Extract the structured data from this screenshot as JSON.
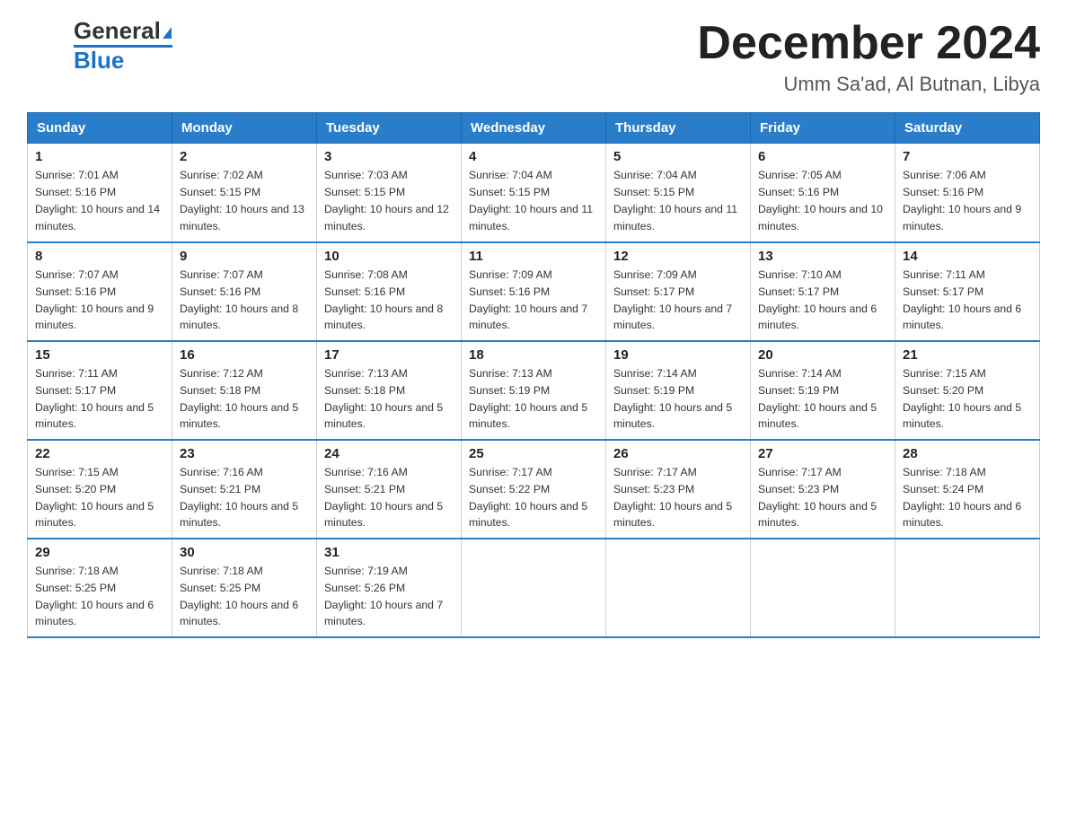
{
  "header": {
    "logo_general": "General",
    "logo_blue": "Blue",
    "month": "December 2024",
    "location": "Umm Sa'ad, Al Butnan, Libya"
  },
  "days_of_week": [
    "Sunday",
    "Monday",
    "Tuesday",
    "Wednesday",
    "Thursday",
    "Friday",
    "Saturday"
  ],
  "weeks": [
    [
      {
        "day": "1",
        "sunrise": "7:01 AM",
        "sunset": "5:16 PM",
        "daylight": "10 hours and 14 minutes."
      },
      {
        "day": "2",
        "sunrise": "7:02 AM",
        "sunset": "5:15 PM",
        "daylight": "10 hours and 13 minutes."
      },
      {
        "day": "3",
        "sunrise": "7:03 AM",
        "sunset": "5:15 PM",
        "daylight": "10 hours and 12 minutes."
      },
      {
        "day": "4",
        "sunrise": "7:04 AM",
        "sunset": "5:15 PM",
        "daylight": "10 hours and 11 minutes."
      },
      {
        "day": "5",
        "sunrise": "7:04 AM",
        "sunset": "5:15 PM",
        "daylight": "10 hours and 11 minutes."
      },
      {
        "day": "6",
        "sunrise": "7:05 AM",
        "sunset": "5:16 PM",
        "daylight": "10 hours and 10 minutes."
      },
      {
        "day": "7",
        "sunrise": "7:06 AM",
        "sunset": "5:16 PM",
        "daylight": "10 hours and 9 minutes."
      }
    ],
    [
      {
        "day": "8",
        "sunrise": "7:07 AM",
        "sunset": "5:16 PM",
        "daylight": "10 hours and 9 minutes."
      },
      {
        "day": "9",
        "sunrise": "7:07 AM",
        "sunset": "5:16 PM",
        "daylight": "10 hours and 8 minutes."
      },
      {
        "day": "10",
        "sunrise": "7:08 AM",
        "sunset": "5:16 PM",
        "daylight": "10 hours and 8 minutes."
      },
      {
        "day": "11",
        "sunrise": "7:09 AM",
        "sunset": "5:16 PM",
        "daylight": "10 hours and 7 minutes."
      },
      {
        "day": "12",
        "sunrise": "7:09 AM",
        "sunset": "5:17 PM",
        "daylight": "10 hours and 7 minutes."
      },
      {
        "day": "13",
        "sunrise": "7:10 AM",
        "sunset": "5:17 PM",
        "daylight": "10 hours and 6 minutes."
      },
      {
        "day": "14",
        "sunrise": "7:11 AM",
        "sunset": "5:17 PM",
        "daylight": "10 hours and 6 minutes."
      }
    ],
    [
      {
        "day": "15",
        "sunrise": "7:11 AM",
        "sunset": "5:17 PM",
        "daylight": "10 hours and 5 minutes."
      },
      {
        "day": "16",
        "sunrise": "7:12 AM",
        "sunset": "5:18 PM",
        "daylight": "10 hours and 5 minutes."
      },
      {
        "day": "17",
        "sunrise": "7:13 AM",
        "sunset": "5:18 PM",
        "daylight": "10 hours and 5 minutes."
      },
      {
        "day": "18",
        "sunrise": "7:13 AM",
        "sunset": "5:19 PM",
        "daylight": "10 hours and 5 minutes."
      },
      {
        "day": "19",
        "sunrise": "7:14 AM",
        "sunset": "5:19 PM",
        "daylight": "10 hours and 5 minutes."
      },
      {
        "day": "20",
        "sunrise": "7:14 AM",
        "sunset": "5:19 PM",
        "daylight": "10 hours and 5 minutes."
      },
      {
        "day": "21",
        "sunrise": "7:15 AM",
        "sunset": "5:20 PM",
        "daylight": "10 hours and 5 minutes."
      }
    ],
    [
      {
        "day": "22",
        "sunrise": "7:15 AM",
        "sunset": "5:20 PM",
        "daylight": "10 hours and 5 minutes."
      },
      {
        "day": "23",
        "sunrise": "7:16 AM",
        "sunset": "5:21 PM",
        "daylight": "10 hours and 5 minutes."
      },
      {
        "day": "24",
        "sunrise": "7:16 AM",
        "sunset": "5:21 PM",
        "daylight": "10 hours and 5 minutes."
      },
      {
        "day": "25",
        "sunrise": "7:17 AM",
        "sunset": "5:22 PM",
        "daylight": "10 hours and 5 minutes."
      },
      {
        "day": "26",
        "sunrise": "7:17 AM",
        "sunset": "5:23 PM",
        "daylight": "10 hours and 5 minutes."
      },
      {
        "day": "27",
        "sunrise": "7:17 AM",
        "sunset": "5:23 PM",
        "daylight": "10 hours and 5 minutes."
      },
      {
        "day": "28",
        "sunrise": "7:18 AM",
        "sunset": "5:24 PM",
        "daylight": "10 hours and 6 minutes."
      }
    ],
    [
      {
        "day": "29",
        "sunrise": "7:18 AM",
        "sunset": "5:25 PM",
        "daylight": "10 hours and 6 minutes."
      },
      {
        "day": "30",
        "sunrise": "7:18 AM",
        "sunset": "5:25 PM",
        "daylight": "10 hours and 6 minutes."
      },
      {
        "day": "31",
        "sunrise": "7:19 AM",
        "sunset": "5:26 PM",
        "daylight": "10 hours and 7 minutes."
      },
      null,
      null,
      null,
      null
    ]
  ]
}
